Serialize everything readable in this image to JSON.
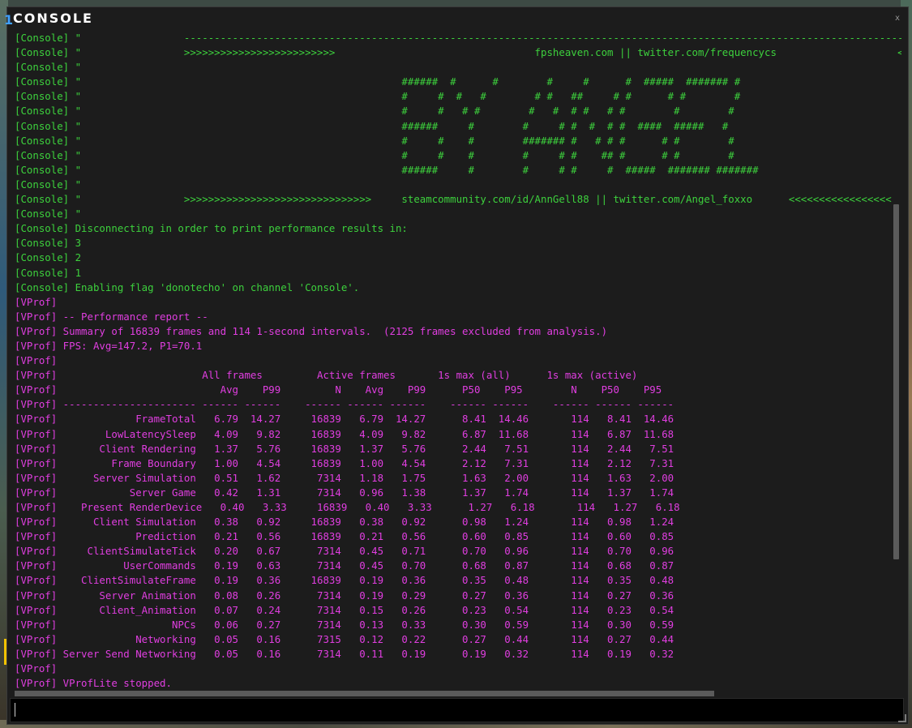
{
  "window": {
    "title": "CONSOLE",
    "title_accent": "1",
    "close_label": "x"
  },
  "colors": {
    "console_text": "#3dd13d",
    "vprof_text": "#e03ee0",
    "background": "#1c1c1c"
  },
  "output": {
    "lines": [
      {
        "channel": "console",
        "text": "[Console] \"                 -------------------------------------------------------------------------------------------------------------------------------------------"
      },
      {
        "channel": "console",
        "text": "[Console] \"                 >>>>>>>>>>>>>>>>>>>>>>>>>                                 fpsheaven.com || twitter.com/frequencycs                    <<<<<<<<"
      },
      {
        "channel": "console",
        "text": "[Console] \""
      },
      {
        "channel": "console",
        "text": "[Console] \"                                                     ######  #      #        #     #      #  #####  ####### #"
      },
      {
        "channel": "console",
        "text": "[Console] \"                                                     #     #  #   #        # #   ##     # #      # #        #"
      },
      {
        "channel": "console",
        "text": "[Console] \"                                                     #     #   # #        #   #  # #   # #        #        #"
      },
      {
        "channel": "console",
        "text": "[Console] \"                                                     ######     #        #     # #  #  # #  ####  #####   #"
      },
      {
        "channel": "console",
        "text": "[Console] \"                                                     #     #    #        ####### #   # # #      # #        #"
      },
      {
        "channel": "console",
        "text": "[Console] \"                                                     #     #    #        #     # #    ## #      # #        #"
      },
      {
        "channel": "console",
        "text": "[Console] \"                                                     ######     #        #     # #     #  #####  ####### #######"
      },
      {
        "channel": "console",
        "text": "[Console] \""
      },
      {
        "channel": "console",
        "text": "[Console] \"                 >>>>>>>>>>>>>>>>>>>>>>>>>>>>>>>     steamcommunity.com/id/AnnGell88 || twitter.com/Angel_foxxo      <<<<<<<<<<<<<<<<<"
      },
      {
        "channel": "console",
        "text": "[Console] \""
      },
      {
        "channel": "console",
        "text": "[Console] Disconnecting in order to print performance results in:"
      },
      {
        "channel": "console",
        "text": "[Console] 3"
      },
      {
        "channel": "console",
        "text": "[Console] 2"
      },
      {
        "channel": "console",
        "text": "[Console] 1"
      },
      {
        "channel": "console",
        "text": "[Console] Enabling flag 'donotecho' on channel 'Console'."
      },
      {
        "channel": "vprof",
        "text": "[VProf]"
      },
      {
        "channel": "vprof",
        "text": "[VProf] -- Performance report --"
      },
      {
        "channel": "vprof",
        "text": "[VProf] Summary of 16839 frames and 114 1-second intervals.  (2125 frames excluded from analysis.)"
      },
      {
        "channel": "vprof",
        "text": "[VProf] FPS: Avg=147.2, P1=70.1"
      },
      {
        "channel": "vprof",
        "text": "[VProf]"
      },
      {
        "channel": "vprof",
        "text": "[VProf]                        All frames         Active frames       1s max (all)      1s max (active)"
      },
      {
        "channel": "vprof",
        "text": "[VProf]                           Avg    P99         N    Avg    P99      P50    P95        N    P50    P95"
      },
      {
        "channel": "vprof",
        "text": "[VProf] ---------------------- ------ ------    ------ ------ ------    ------ ------    ------ ------ ------"
      },
      {
        "channel": "vprof",
        "text": "[VProf]             FrameTotal   6.79  14.27     16839   6.79  14.27      8.41  14.46       114   8.41  14.46"
      },
      {
        "channel": "vprof",
        "text": "[VProf]        LowLatencySleep   4.09   9.82     16839   4.09   9.82      6.87  11.68       114   6.87  11.68"
      },
      {
        "channel": "vprof",
        "text": "[VProf]       Client Rendering   1.37   5.76     16839   1.37   5.76      2.44   7.51       114   2.44   7.51"
      },
      {
        "channel": "vprof",
        "text": "[VProf]         Frame Boundary   1.00   4.54     16839   1.00   4.54      2.12   7.31       114   2.12   7.31"
      },
      {
        "channel": "vprof",
        "text": "[VProf]      Server Simulation   0.51   1.62      7314   1.18   1.75      1.63   2.00       114   1.63   2.00"
      },
      {
        "channel": "vprof",
        "text": "[VProf]            Server Game   0.42   1.31      7314   0.96   1.38      1.37   1.74       114   1.37   1.74"
      },
      {
        "channel": "vprof",
        "text": "[VProf]    Present RenderDevice   0.40   3.33     16839   0.40   3.33      1.27   6.18       114   1.27   6.18"
      },
      {
        "channel": "vprof",
        "text": "[VProf]      Client Simulation   0.38   0.92     16839   0.38   0.92      0.98   1.24       114   0.98   1.24"
      },
      {
        "channel": "vprof",
        "text": "[VProf]             Prediction   0.21   0.56     16839   0.21   0.56      0.60   0.85       114   0.60   0.85"
      },
      {
        "channel": "vprof",
        "text": "[VProf]     ClientSimulateTick   0.20   0.67      7314   0.45   0.71      0.70   0.96       114   0.70   0.96"
      },
      {
        "channel": "vprof",
        "text": "[VProf]           UserCommands   0.19   0.63      7314   0.45   0.70      0.68   0.87       114   0.68   0.87"
      },
      {
        "channel": "vprof",
        "text": "[VProf]    ClientSimulateFrame   0.19   0.36     16839   0.19   0.36      0.35   0.48       114   0.35   0.48"
      },
      {
        "channel": "vprof",
        "text": "[VProf]       Server Animation   0.08   0.26      7314   0.19   0.29      0.27   0.36       114   0.27   0.36"
      },
      {
        "channel": "vprof",
        "text": "[VProf]       Client_Animation   0.07   0.24      7314   0.15   0.26      0.23   0.54       114   0.23   0.54"
      },
      {
        "channel": "vprof",
        "text": "[VProf]                   NPCs   0.06   0.27      7314   0.13   0.33      0.30   0.59       114   0.30   0.59"
      },
      {
        "channel": "vprof",
        "text": "[VProf]             Networking   0.05   0.16      7315   0.12   0.22      0.27   0.44       114   0.27   0.44"
      },
      {
        "channel": "vprof",
        "text": "[VProf] Server Send Networking   0.05   0.16      7314   0.11   0.19      0.19   0.32       114   0.19   0.32"
      },
      {
        "channel": "vprof",
        "text": "[VProf]"
      },
      {
        "channel": "vprof",
        "text": "[VProf] VProfLite stopped."
      }
    ]
  },
  "input": {
    "value": "",
    "placeholder": ""
  }
}
